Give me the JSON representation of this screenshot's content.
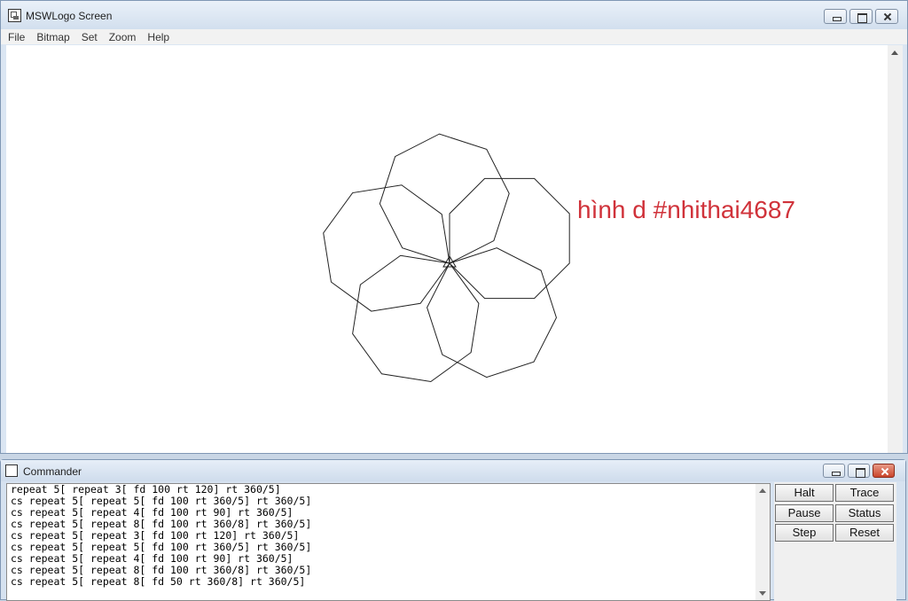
{
  "window": {
    "title": "MSWLogo Screen",
    "menu": [
      "File",
      "Bitmap",
      "Set",
      "Zoom",
      "Help"
    ]
  },
  "canvas": {
    "annotation": "hình d #nhithai4687",
    "annotation_color": "#d0323a",
    "drawing": {
      "description_icon": "turtle-drawing",
      "repeat_outer": 5,
      "polygon_sides": 8,
      "side_length": 100
    }
  },
  "commander": {
    "title": "Commander",
    "history": [
      "repeat 5[ repeat 3[ fd 100 rt 120] rt 360/5]",
      "cs repeat 5[ repeat 5[ fd 100 rt 360/5] rt 360/5]",
      "cs repeat 5[ repeat 4[ fd 100 rt 90] rt 360/5]",
      "cs repeat 5[ repeat 8[ fd 100 rt 360/8] rt 360/5]",
      "cs repeat 5[ repeat 3[ fd 100 rt 120] rt 360/5]",
      "cs repeat 5[ repeat 5[ fd 100 rt 360/5] rt 360/5]",
      "cs repeat 5[ repeat 4[ fd 100 rt 90] rt 360/5]",
      "cs repeat 5[ repeat 8[ fd 100 rt 360/8] rt 360/5]",
      "cs repeat 5[ repeat 8[ fd 50 rt 360/8] rt 360/5]"
    ],
    "buttons": {
      "halt": "Halt",
      "trace": "Trace",
      "pause": "Pause",
      "status": "Status",
      "step": "Step",
      "reset": "Reset"
    }
  },
  "icons": {
    "app": "mswlogo-app-icon",
    "minimize": "minimize-icon",
    "maximize": "maximize-icon",
    "close": "close-icon"
  }
}
